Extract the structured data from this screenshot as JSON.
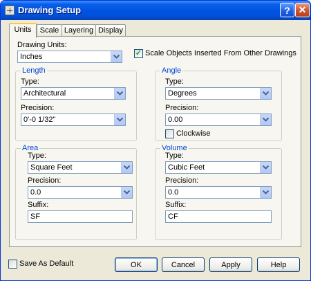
{
  "window": {
    "title": "Drawing Setup",
    "help_glyph": "?",
    "close_glyph": "✕"
  },
  "tabs": [
    {
      "label": "Units",
      "active": true
    },
    {
      "label": "Scale",
      "active": false
    },
    {
      "label": "Layering",
      "active": false
    },
    {
      "label": "Display",
      "active": false
    }
  ],
  "units": {
    "drawing_units_label": "Drawing Units:",
    "drawing_units_value": "Inches",
    "scale_objects_label": "Scale Objects Inserted From Other Drawings",
    "scale_objects_checked": true
  },
  "length": {
    "title": "Length",
    "type_label": "Type:",
    "type_value": "Architectural",
    "precision_label": "Precision:",
    "precision_value": "0'-0 1/32\""
  },
  "angle": {
    "title": "Angle",
    "type_label": "Type:",
    "type_value": "Degrees",
    "precision_label": "Precision:",
    "precision_value": "0.00",
    "clockwise_label": "Clockwise",
    "clockwise_checked": false
  },
  "area": {
    "title": "Area",
    "type_label": "Type:",
    "type_value": "Square Feet",
    "precision_label": "Precision:",
    "precision_value": "0.0",
    "suffix_label": "Suffix:",
    "suffix_value": "SF"
  },
  "volume": {
    "title": "Volume",
    "type_label": "Type:",
    "type_value": "Cubic Feet",
    "precision_label": "Precision:",
    "precision_value": "0.0",
    "suffix_label": "Suffix:",
    "suffix_value": "CF"
  },
  "footer": {
    "save_default_label": "Save As Default",
    "save_default_checked": false,
    "ok_label": "OK",
    "cancel_label": "Cancel",
    "apply_label": "Apply",
    "help_label": "Help"
  },
  "icons": {
    "dropdown_arrow": "chevron-down-icon",
    "check_mark": "✓"
  }
}
